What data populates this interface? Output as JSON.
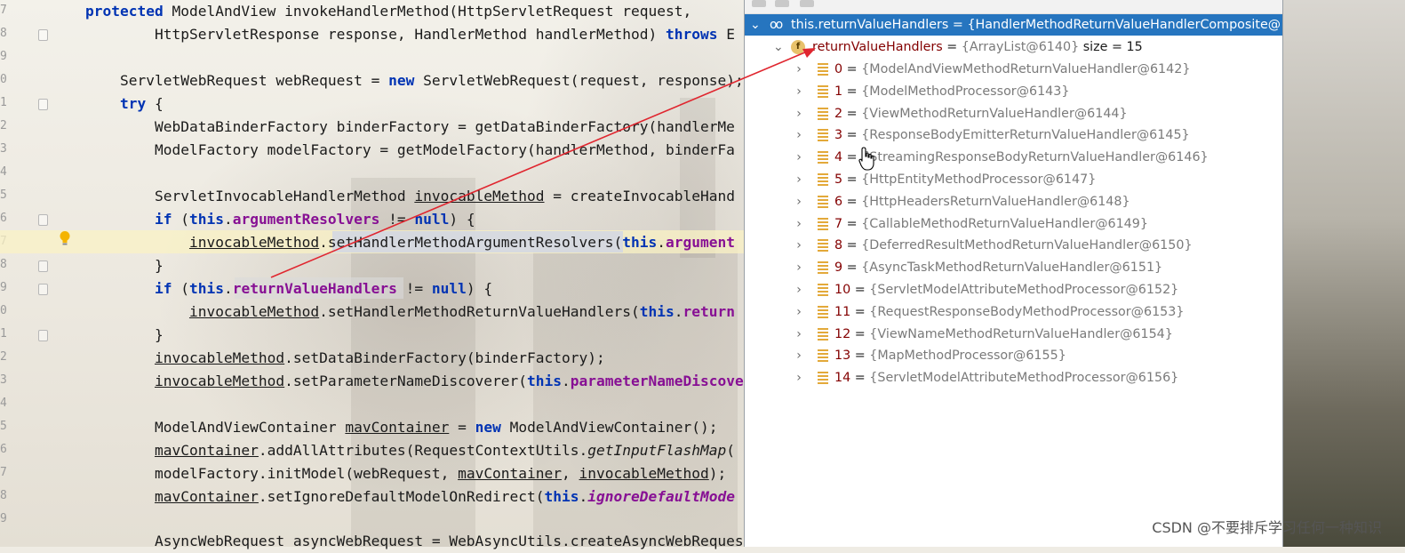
{
  "editor": {
    "line_numbers": [
      "7",
      "8",
      "9",
      "0",
      "1",
      "2",
      "3",
      "4",
      "5",
      "6",
      "7",
      "8",
      "9",
      "0",
      "1",
      "2",
      "3",
      "4",
      "5",
      "6",
      "7",
      "8",
      "9"
    ],
    "code": {
      "l1": {
        "kw": "protected",
        "rest": " ModelAndView invokeHandlerMethod(HttpServletRequest request,"
      },
      "l2": {
        "a": "        HttpServletResponse response, HandlerMethod handlerMethod) ",
        "kw": "throws",
        "b": " E"
      },
      "l3": {
        "a": "    ServletWebRequest webRequest = ",
        "kw": "new",
        "b": " ServletWebRequest(request, response);"
      },
      "l4": {
        "kw": "    try",
        "b": " {"
      },
      "l5": {
        "a": "        WebDataBinderFactory binderFactory = getDataBinderFactory(handlerMe"
      },
      "l6": {
        "a": "        ModelFactory modelFactory = getModelFactory(handlerMethod, binderFa"
      },
      "l7": {
        "a": "        ServletInvocableHandlerMethod ",
        "u": "invocableMethod",
        "b": " = createInvocableHand"
      },
      "l8": {
        "kw": "        if",
        "a": " (",
        "kw2": "this",
        "dot": ".",
        "fld": "argumentResolvers",
        "b": " != ",
        "kw3": "null",
        "c": ") {"
      },
      "l9": {
        "pad": "            ",
        "u": "invocableMethod",
        "a": ".setHandlerMethodArgumentResolvers(",
        "kw": "this",
        "dot": ".",
        "fld": "argument"
      },
      "l10": {
        "a": "        }"
      },
      "l11": {
        "kw": "        if",
        "a": " (",
        "kw2": "this",
        "dot": ".",
        "fld": "returnValueHandlers",
        "b": " != ",
        "kw3": "null",
        "c": ") {"
      },
      "l12": {
        "pad": "            ",
        "u": "invocableMethod",
        "a": ".setHandlerMethodReturnValueHandlers(",
        "kw": "this",
        "dot": ".",
        "fld": "return"
      },
      "l13": {
        "a": "        }"
      },
      "l14": {
        "pad": "        ",
        "u": "invocableMethod",
        "a": ".setDataBinderFactory(binderFactory);"
      },
      "l15": {
        "pad": "        ",
        "u": "invocableMethod",
        "a": ".setParameterNameDiscoverer(",
        "kw": "this",
        "dot": ".",
        "fld": "parameterNameDiscove"
      },
      "l16": {
        "a": "        ModelAndViewContainer ",
        "u": "mavContainer",
        "b": " = ",
        "kw": "new",
        "c": " ModelAndViewContainer();"
      },
      "l17": {
        "pad": "        ",
        "u": "mavContainer",
        "a": ".addAllAttributes(RequestContextUtils.",
        "it": "getInputFlashMap",
        "b": "("
      },
      "l18": {
        "a": "        modelFactory.initModel(webRequest, ",
        "u": "mavContainer",
        "b": ", ",
        "u2": "invocableMethod",
        "c": ");"
      },
      "l19": {
        "pad": "        ",
        "u": "mavContainer",
        "a": ".setIgnoreDefaultModelOnRedirect(",
        "kw": "this",
        "dot": ".",
        "fld": "ignoreDefaultMode"
      },
      "l20": {
        "a": "        AsyncWebRequest asyncWebRequest = WebAsyncUtils.createAsyncWebReques"
      }
    }
  },
  "debugger": {
    "root": {
      "name": "this.returnValueHandlers",
      "eq": " = ",
      "val": "{HandlerMethodReturnValueHandlerComposite@"
    },
    "field": {
      "name": "returnValueHandlers",
      "eq": " = ",
      "val": "{ArrayList@6140}",
      "size": " size = 15"
    },
    "items": [
      {
        "index": "0",
        "eq": " = ",
        "val": "{ModelAndViewMethodReturnValueHandler@6142}"
      },
      {
        "index": "1",
        "eq": " = ",
        "val": "{ModelMethodProcessor@6143}"
      },
      {
        "index": "2",
        "eq": " = ",
        "val": "{ViewMethodReturnValueHandler@6144}"
      },
      {
        "index": "3",
        "eq": " = ",
        "val": "{ResponseBodyEmitterReturnValueHandler@6145}"
      },
      {
        "index": "4",
        "eq": " = ",
        "val": "{StreamingResponseBodyReturnValueHandler@6146}"
      },
      {
        "index": "5",
        "eq": " = ",
        "val": "{HttpEntityMethodProcessor@6147}"
      },
      {
        "index": "6",
        "eq": " = ",
        "val": "{HttpHeadersReturnValueHandler@6148}"
      },
      {
        "index": "7",
        "eq": " = ",
        "val": "{CallableMethodReturnValueHandler@6149}"
      },
      {
        "index": "8",
        "eq": " = ",
        "val": "{DeferredResultMethodReturnValueHandler@6150}"
      },
      {
        "index": "9",
        "eq": " = ",
        "val": "{AsyncTaskMethodReturnValueHandler@6151}"
      },
      {
        "index": "10",
        "eq": " = ",
        "val": "{ServletModelAttributeMethodProcessor@6152}"
      },
      {
        "index": "11",
        "eq": " = ",
        "val": "{RequestResponseBodyMethodProcessor@6153}"
      },
      {
        "index": "12",
        "eq": " = ",
        "val": "{ViewNameMethodReturnValueHandler@6154}"
      },
      {
        "index": "13",
        "eq": " = ",
        "val": "{MapMethodProcessor@6155}"
      },
      {
        "index": "14",
        "eq": " = ",
        "val": "{ServletModelAttributeMethodProcessor@6156}"
      }
    ]
  },
  "icons": {
    "expand_down": "chevron-down-icon",
    "expand_right": "chevron-right-icon",
    "watch": "glasses-icon",
    "field": "field-icon",
    "list": "list-item-icon",
    "bulb": "lightbulb-icon",
    "cursor": "hand-cursor-icon"
  },
  "colors": {
    "selection": "#2675bf",
    "annotation_arrow": "#e0262f",
    "keyword": "#0033b3",
    "field": "#871094"
  },
  "watermark": "CSDN @不要排斥学习任何一种知识"
}
